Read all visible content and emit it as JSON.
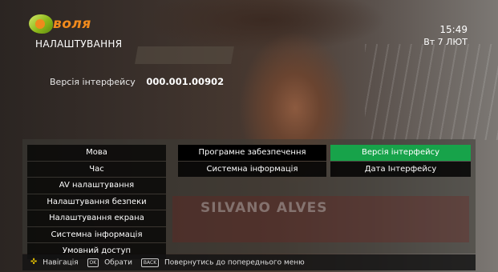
{
  "brand": {
    "logo_text": "воля"
  },
  "header": {
    "title": "НАЛАШТУВАННЯ",
    "time": "15:49",
    "date": "Вт 7 ЛЮТ"
  },
  "info": {
    "label": "Версія інтерфейсу",
    "value": "000.001.00902"
  },
  "menu": {
    "column1": [
      "Мова",
      "Час",
      "AV налаштування",
      "Налаштування безпеки",
      "Налаштування екрана",
      "Системна інформація",
      "Умовний доступ"
    ],
    "column2": [
      "Програмне забезпечення",
      "Системна інформація"
    ],
    "column3": [
      "Версія інтерфейсу",
      "Дата Інтерфейсу"
    ],
    "selected_column1_index": 5,
    "focused_column3_index": 0
  },
  "background_video": {
    "overlay_name": "SILVANO ALVES"
  },
  "hints": {
    "navigation": "Навігація",
    "ok_key": "OK",
    "select": "Обрати",
    "back_key": "BACK",
    "back": "Повернутись до попереднього меню"
  },
  "colors": {
    "focus": "#17a34a",
    "brand_orange": "#f08a1c",
    "brand_green": "#8db91a"
  }
}
